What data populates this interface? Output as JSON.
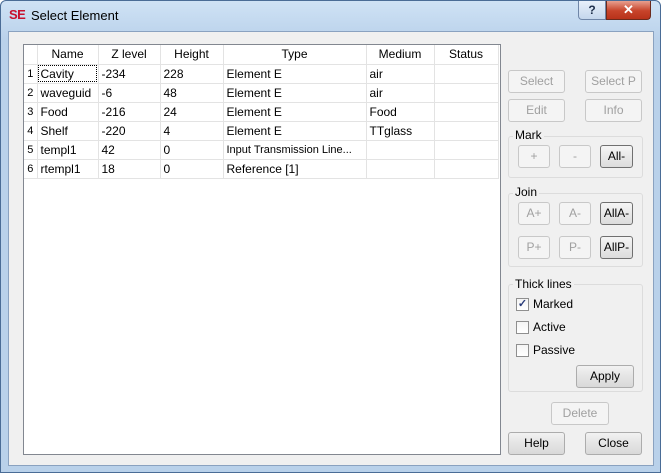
{
  "window": {
    "app_icon_text": "SE",
    "title": "Select Element",
    "help_glyph": "?",
    "close_glyph": "✕"
  },
  "table": {
    "columns": [
      "Name",
      "Z level",
      "Height",
      "Type",
      "Medium",
      "Status"
    ],
    "rows": [
      {
        "num": "1",
        "name": "Cavity",
        "z": "-234",
        "height": "228",
        "type": "Element E",
        "medium": "air",
        "status": ""
      },
      {
        "num": "2",
        "name": "waveguid",
        "z": "-6",
        "height": "48",
        "type": "Element E",
        "medium": "air",
        "status": ""
      },
      {
        "num": "3",
        "name": "Food",
        "z": "-216",
        "height": "24",
        "type": "Element E",
        "medium": "Food",
        "status": ""
      },
      {
        "num": "4",
        "name": "Shelf",
        "z": "-220",
        "height": "4",
        "type": "Element E",
        "medium": "TTglass",
        "status": ""
      },
      {
        "num": "5",
        "name": "templ1",
        "z": "42",
        "height": "0",
        "type": "Input Transmission Line...",
        "medium": "",
        "status": ""
      },
      {
        "num": "6",
        "name": "rtempl1",
        "z": "18",
        "height": "0",
        "type": "Reference [1]",
        "medium": "",
        "status": ""
      }
    ]
  },
  "buttons": {
    "select": "Select",
    "select_p": "Select P",
    "edit": "Edit",
    "info": "Info",
    "delete": "Delete",
    "help": "Help",
    "close": "Close",
    "apply": "Apply"
  },
  "mark": {
    "label": "Mark",
    "plus": "+",
    "minus": "-",
    "all_minus": "All-"
  },
  "join": {
    "label": "Join",
    "a_plus": "A+",
    "a_minus": "A-",
    "all_a_minus": "AllA-",
    "p_plus": "P+",
    "p_minus": "P-",
    "all_p_minus": "AllP-"
  },
  "thick_lines": {
    "label": "Thick lines",
    "marked": {
      "label": "Marked",
      "checked": true
    },
    "active": {
      "label": "Active",
      "checked": false
    },
    "passive": {
      "label": "Passive",
      "checked": false
    }
  }
}
